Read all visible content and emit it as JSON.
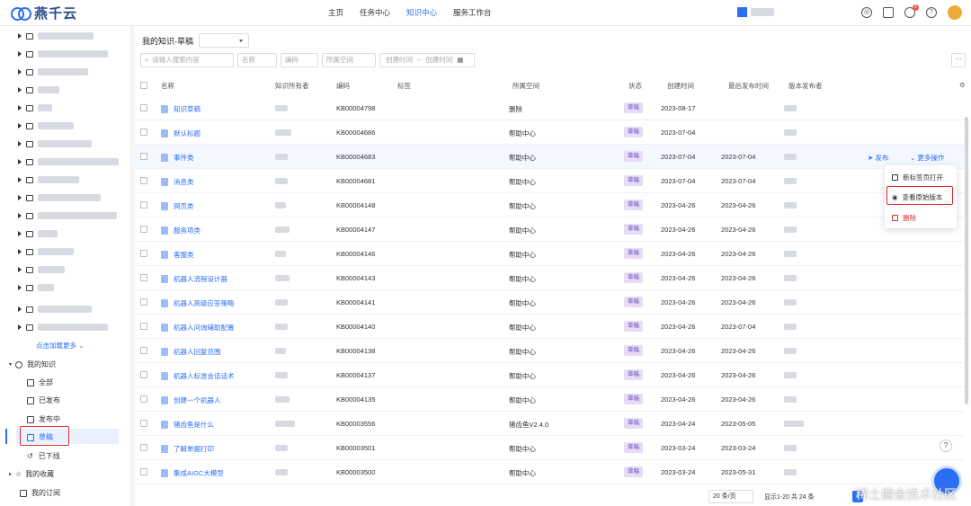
{
  "app": {
    "brand": "燕千云"
  },
  "nav": [
    "主页",
    "任务中心",
    "知识中心",
    "服务工作台"
  ],
  "nav_active": 2,
  "header_icons": [
    "help-ring-icon",
    "calendar-icon",
    "bell-icon",
    "question-icon"
  ],
  "notification_count": "1",
  "sidebar": {
    "more_link": "点击加载更多",
    "sections": {
      "my_knowledge": "我的知识",
      "all": "全部",
      "published": "已发布",
      "publishing": "发布中",
      "draft": "草稿",
      "offline": "已下线",
      "favorites": "我的收藏",
      "subscriptions": "我的订阅"
    }
  },
  "main": {
    "title": "我的知识-草稿",
    "filters": {
      "search_placeholder": "请输入搜索内容",
      "name": "名称",
      "code": "编码",
      "space": "所属空间",
      "created_time": "创建时间",
      "tilde": "~",
      "created_time_end": "创建时间"
    },
    "columns": [
      "名称",
      "知识所有者",
      "编码",
      "标签",
      "所属空间",
      "状态",
      "创建时间",
      "最后发布时间",
      "版本发布者"
    ],
    "rows": [
      {
        "name": "知识草稿",
        "code": "KB00004798",
        "space": "删除",
        "status": "草稿",
        "created": "2023-08-17",
        "published": ""
      },
      {
        "name": "默认标题",
        "code": "KB00004686",
        "space": "帮助中心",
        "status": "草稿",
        "created": "2023-07-04",
        "published": ""
      },
      {
        "name": "事件类",
        "code": "KB00004683",
        "space": "帮助中心",
        "status": "草稿",
        "created": "2023-07-04",
        "published": "2023-07-04"
      },
      {
        "name": "消息类",
        "code": "KB00004681",
        "space": "帮助中心",
        "status": "草稿",
        "created": "2023-07-04",
        "published": "2023-07-04"
      },
      {
        "name": "网页类",
        "code": "KB00004148",
        "space": "帮助中心",
        "status": "草稿",
        "created": "2023-04-26",
        "published": "2023-04-26"
      },
      {
        "name": "服务项类",
        "code": "KB00004147",
        "space": "帮助中心",
        "status": "草稿",
        "created": "2023-04-26",
        "published": "2023-04-26"
      },
      {
        "name": "客服类",
        "code": "KB00004146",
        "space": "帮助中心",
        "status": "草稿",
        "created": "2023-04-26",
        "published": "2023-04-26"
      },
      {
        "name": "机器人流程设计器",
        "code": "KB00004143",
        "space": "帮助中心",
        "status": "草稿",
        "created": "2023-04-26",
        "published": "2023-04-26"
      },
      {
        "name": "机器人高级应答策略",
        "code": "KB00004141",
        "space": "帮助中心",
        "status": "草稿",
        "created": "2023-04-26",
        "published": "2023-04-26"
      },
      {
        "name": "机器人问询辅助配置",
        "code": "KB00004140",
        "space": "帮助中心",
        "status": "草稿",
        "created": "2023-04-26",
        "published": "2023-07-04"
      },
      {
        "name": "机器人回复范围",
        "code": "KB00004138",
        "space": "帮助中心",
        "status": "草稿",
        "created": "2023-04-26",
        "published": "2023-04-26"
      },
      {
        "name": "机器人标准会话话术",
        "code": "KB00004137",
        "space": "帮助中心",
        "status": "草稿",
        "created": "2023-04-26",
        "published": "2023-04-26"
      },
      {
        "name": "创建一个机器人",
        "code": "KB00004135",
        "space": "帮助中心",
        "status": "草稿",
        "created": "2023-04-26",
        "published": "2023-04-26"
      },
      {
        "name": "猪齿鱼是什么",
        "code": "KB00003556",
        "space": "猪齿鱼V2.4.0",
        "status": "草稿",
        "created": "2023-04-24",
        "published": "2023-05-05"
      },
      {
        "name": "了解单据打印",
        "code": "KB00003501",
        "space": "帮助中心",
        "status": "草稿",
        "created": "2023-03-24",
        "published": "2023-03-24"
      },
      {
        "name": "集成AIGC大模型",
        "code": "KB00003500",
        "space": "帮助中心",
        "status": "草稿",
        "created": "2023-03-24",
        "published": "2023-05-31"
      }
    ],
    "row_actions": {
      "publish": "发布",
      "more": "更多操作"
    },
    "dropdown": [
      "新标签页打开",
      "查看原始版本",
      "删除"
    ]
  },
  "pager": {
    "page_size": "20 条/页",
    "info": "显示1-20 共 24 条",
    "current_page": "1"
  },
  "watermark": "稀土掘金技术社区",
  "colors": {
    "accent": "#2a6ef3",
    "status_bg": "#e7dcf7",
    "danger": "#e02a2a"
  }
}
